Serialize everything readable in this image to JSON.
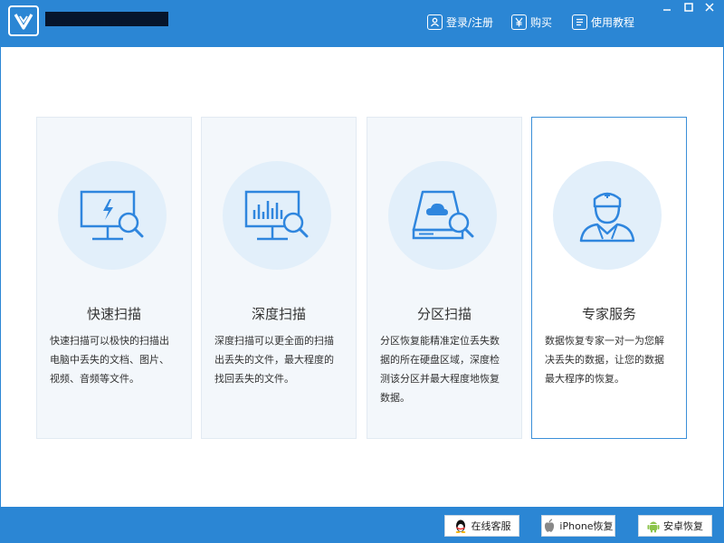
{
  "app": {
    "title": "■■■■■■■■■"
  },
  "header": {
    "links": [
      {
        "label": "登录/注册",
        "icon": "user-login-icon"
      },
      {
        "label": "购买",
        "icon": "yen-icon"
      },
      {
        "label": "使用教程",
        "icon": "document-icon"
      }
    ],
    "window_controls": [
      "minimize-icon",
      "maximize-icon",
      "close-icon"
    ]
  },
  "cards": [
    {
      "title": "快速扫描",
      "icon": "monitor-lightning-search-icon",
      "desc": [
        "快速扫描可以极快的扫描出",
        "电脑中丢失的文档、图片、",
        "视频、音频等文件。"
      ]
    },
    {
      "title": "深度扫描",
      "icon": "monitor-chart-search-icon",
      "desc": [
        "深度扫描可以更全面的扫描",
        "出丢失的文件，最大程度的",
        "找回丢失的文件。"
      ]
    },
    {
      "title": "分区扫描",
      "icon": "disk-cloud-search-icon",
      "desc": [
        "分区恢复能精准定位丢失数",
        "据的所在硬盘区域，深度检",
        "测该分区并最大程度地恢复",
        "数据。"
      ]
    },
    {
      "title": "专家服务",
      "icon": "expert-person-icon",
      "desc": [
        "数据恢复专家一对一为您解",
        "决丢失的数据，让您的数据",
        "最大程序的恢复。"
      ],
      "selected": true
    }
  ],
  "footer": {
    "buttons": [
      {
        "label": "在线客服",
        "icon": "qq-penguin-icon"
      },
      {
        "label": "iPhone恢复",
        "icon": "apple-icon"
      },
      {
        "label": "安卓恢复",
        "icon": "android-icon"
      }
    ]
  },
  "colors": {
    "brand_blue": "#2b86d4",
    "card_bg": "#f3f7fb",
    "icon_circle": "#e2effa",
    "icon_blue": "#2f86de",
    "selected_border": "#3b8fd8"
  }
}
